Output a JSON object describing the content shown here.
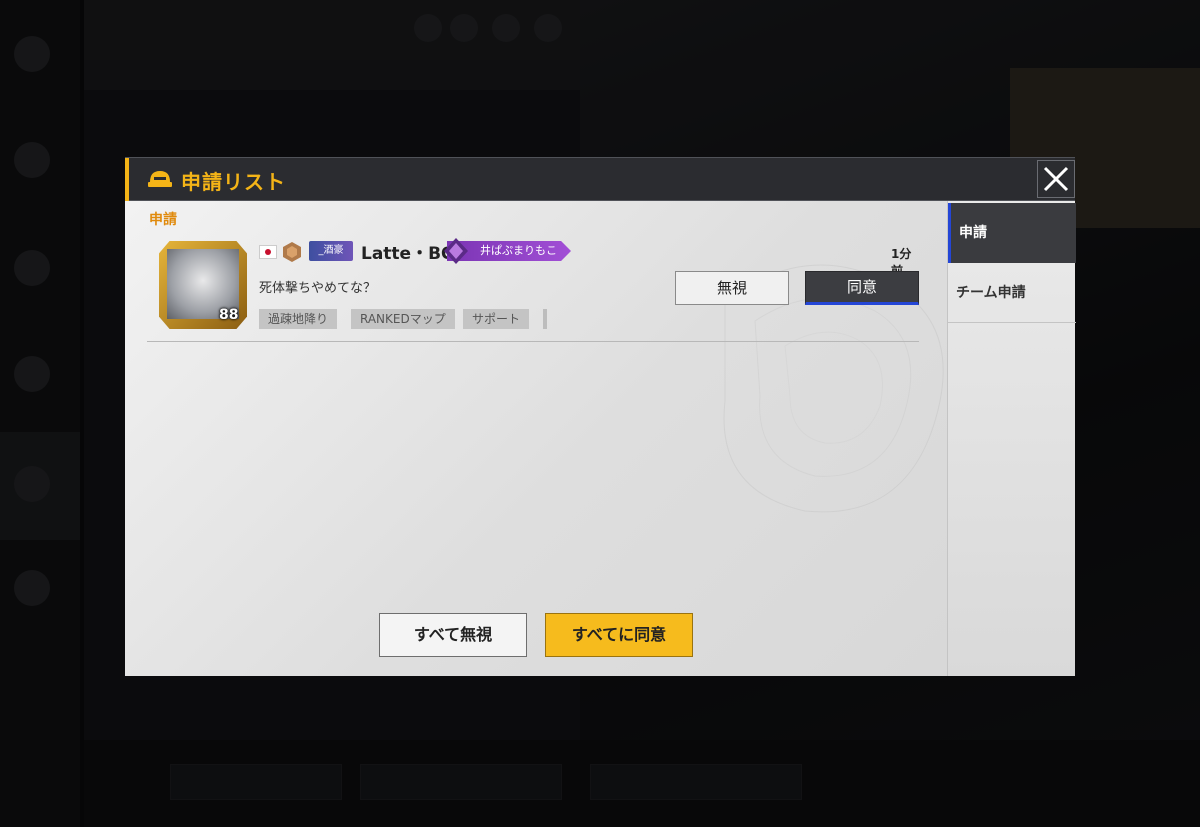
{
  "dialog": {
    "title": "申請リスト",
    "section_label": "申請",
    "close_icon": "close-icon"
  },
  "requests": [
    {
      "player_name": "Latte・BOT",
      "level": "88",
      "clan_tag": "_酒豪",
      "title_badge": "井ぱぷまりもこ",
      "time": "1分前",
      "message": "死体撃ちやめてな？",
      "tags": [
        "過疎地降り",
        "RANKEDマップ",
        "サポート"
      ],
      "ignore_label": "無視",
      "accept_label": "同意"
    }
  ],
  "footer": {
    "ignore_all_label": "すべて無視",
    "accept_all_label": "すべてに同意"
  },
  "side_tabs": [
    {
      "label": "申請",
      "active": true
    },
    {
      "label": "チーム申請",
      "active": false
    }
  ],
  "colors": {
    "accent": "#f4b417",
    "section_orange": "#e08a0c",
    "active_tab": "#3a3b3f",
    "blue_underline": "#2446d6"
  }
}
